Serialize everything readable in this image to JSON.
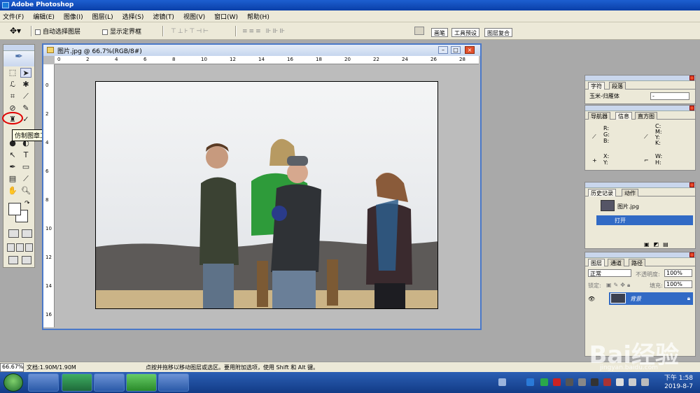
{
  "app": {
    "title": "Adobe Photoshop"
  },
  "menu": [
    "文件(F)",
    "编辑(E)",
    "图像(I)",
    "图层(L)",
    "选择(S)",
    "滤镜(T)",
    "视图(V)",
    "窗口(W)",
    "帮助(H)"
  ],
  "options": {
    "auto_select": "自动选择图层",
    "show_bounds": "显示定界框",
    "tabs": [
      "画笔",
      "工具预设",
      "图层复合"
    ]
  },
  "tooltip": "仿制图章工具 (S)",
  "document": {
    "title": "图片.jpg @ 66.7%(RGB/8#)",
    "ruler_h": [
      "0",
      "2",
      "4",
      "6",
      "8",
      "10",
      "12",
      "14",
      "16",
      "18",
      "20",
      "22",
      "24",
      "26",
      "28"
    ],
    "ruler_v": [
      "0",
      "2",
      "4",
      "6",
      "8",
      "10",
      "12",
      "14",
      "16"
    ]
  },
  "panels": {
    "char": {
      "tabs": [
        "字符",
        "段落"
      ],
      "font": "玉米-归雁体",
      "style": "-"
    },
    "info": {
      "tabs": [
        "导航器",
        "信息",
        "直方图"
      ],
      "rgb": "R:\nG:\nB:",
      "cmyk": "C:\nM:\nY:\nK:",
      "xy": "X:\nY:",
      "wh": "W:\nH:"
    },
    "history": {
      "tabs": [
        "历史记录",
        "动作"
      ],
      "snapshot": "图片.jpg",
      "step": "打开"
    },
    "layers": {
      "tabs": [
        "图层",
        "通道",
        "路径"
      ],
      "blend": "正常",
      "opacity_label": "不透明度:",
      "opacity": "100%",
      "lock_label": "锁定:",
      "fill_label": "填充:",
      "fill": "100%",
      "layer_name": "背景"
    }
  },
  "status": {
    "zoom": "66.67%",
    "doc": "文档:1.90M/1.90M",
    "hint": "点按并拖移以移动图层或选区。要用附加选项，使用 Shift 和 Alt 键。"
  },
  "taskbar": {
    "time": "下午 1:58",
    "date": "2019-8-7"
  },
  "watermark": {
    "brand": "Bai经验",
    "url": "jingyan.baidu.com"
  },
  "colors": {
    "title": "#0a3fa8",
    "selection": "#316ac5",
    "highlight": "#e00000"
  }
}
